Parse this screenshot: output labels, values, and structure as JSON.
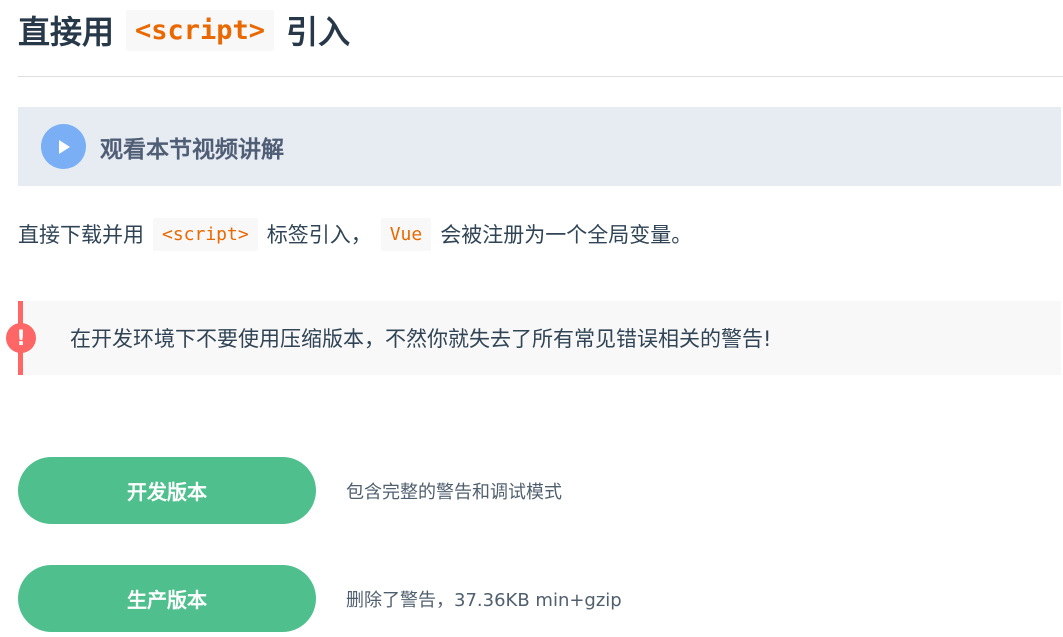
{
  "heading": {
    "prefix": "直接用",
    "code": "<script>",
    "suffix": "引入"
  },
  "video": {
    "label": "观看本节视频讲解",
    "icon": "play-icon",
    "icon_color": "#7aaef5"
  },
  "intro": {
    "part1": "直接下载并用",
    "code1": "<script>",
    "part2": "标签引入，",
    "code2": "Vue",
    "part3": "会被注册为一个全局变量。"
  },
  "tip": {
    "icon": "exclamation-icon",
    "accent_color": "#ff6666",
    "text": "在开发环境下不要使用压缩版本，不然你就失去了所有常见错误相关的警告!"
  },
  "downloads": [
    {
      "label": "开发版本",
      "description": "包含完整的警告和调试模式"
    },
    {
      "label": "生产版本",
      "description": "删除了警告，37.36KB min+gzip"
    }
  ],
  "colors": {
    "button": "#4fc08d",
    "code": "#e96900"
  }
}
